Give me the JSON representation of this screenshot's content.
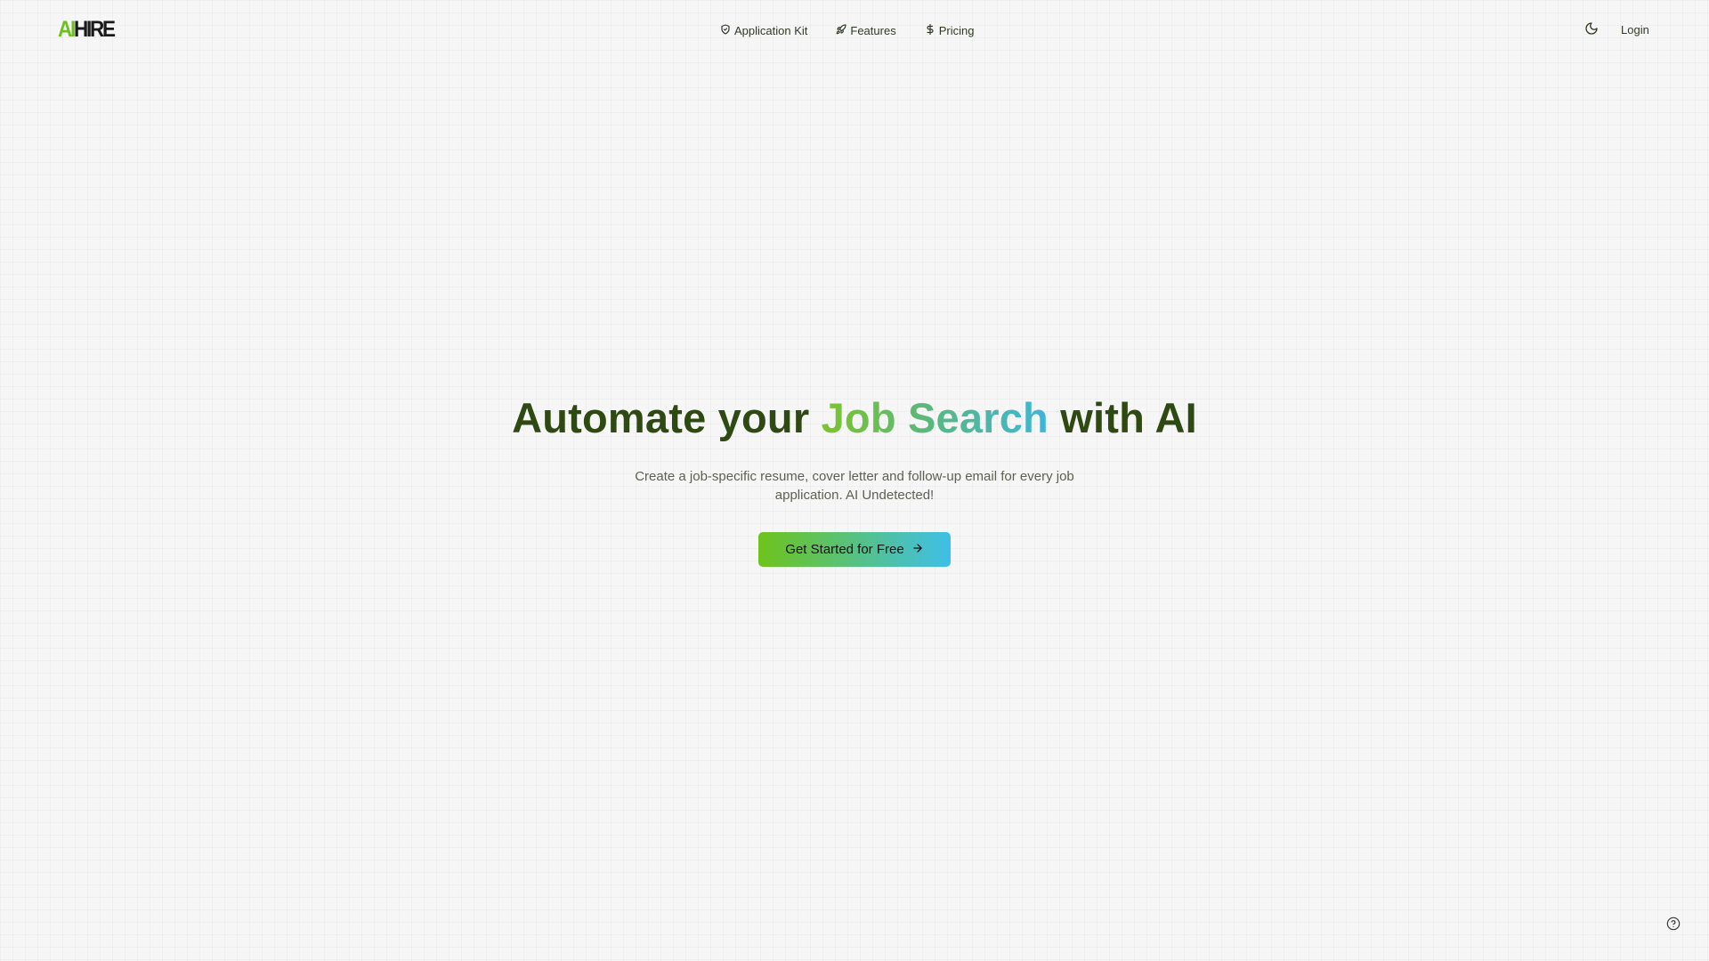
{
  "logo": {
    "ai": "AI",
    "hire": "HIRE"
  },
  "nav": {
    "items": [
      {
        "label": "Application Kit",
        "icon": "shield-icon"
      },
      {
        "label": "Features",
        "icon": "rocket-icon"
      },
      {
        "label": "Pricing",
        "icon": "dollar-icon"
      }
    ]
  },
  "header": {
    "theme_icon": "moon-icon",
    "login_label": "Login"
  },
  "hero": {
    "title_prefix": "Automate your ",
    "title_highlight": "Job Search",
    "title_suffix": " with AI",
    "subtitle": "Create a job-specific resume, cover letter and follow-up email for every job application. AI Undetected!",
    "cta_label": "Get Started for Free",
    "cta_icon": "arrow-right-icon"
  },
  "help": {
    "icon": "help-circle-icon"
  },
  "colors": {
    "brand_green": "#6ec01e",
    "brand_blue": "#3fbfe8",
    "heading_dark": "#2e4a12",
    "background": "#f6f6f7"
  }
}
